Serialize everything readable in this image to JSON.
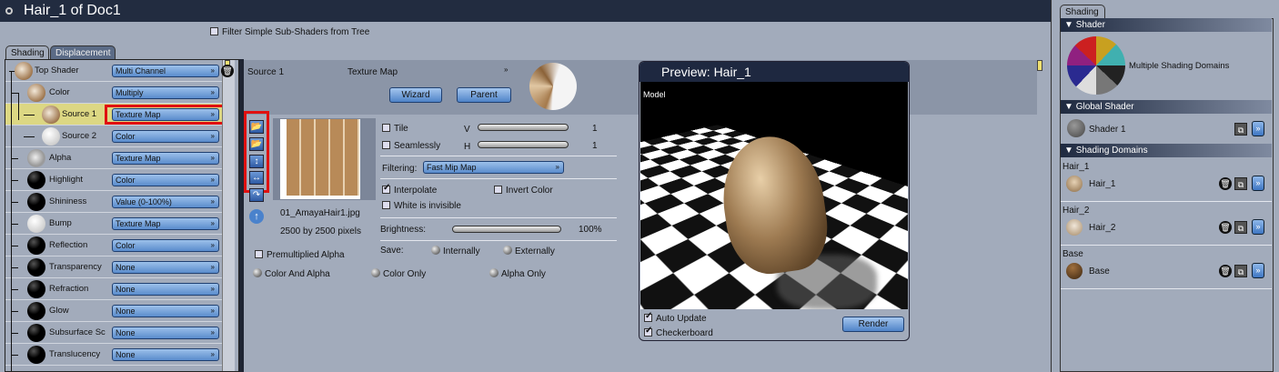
{
  "title": "Hair_1 of Doc1",
  "filter_label": "Filter Simple Sub-Shaders from Tree",
  "tabs": [
    "Shading",
    "Displacement"
  ],
  "tree": [
    {
      "label": "Top Shader",
      "value": "Multi Channel",
      "ball": "hair",
      "level": 0
    },
    {
      "label": "Color",
      "value": "Multiply",
      "ball": "hair",
      "level": 1
    },
    {
      "label": "Source 1",
      "value": "Texture Map",
      "ball": "hair",
      "level": 2,
      "selected": true
    },
    {
      "label": "Source 2",
      "value": "Color",
      "ball": "white",
      "level": 2
    },
    {
      "label": "Alpha",
      "value": "Texture Map",
      "ball": "alpha",
      "level": 1
    },
    {
      "label": "Highlight",
      "value": "Color",
      "ball": "black",
      "level": 1
    },
    {
      "label": "Shininess",
      "value": "Value (0-100%)",
      "ball": "black",
      "level": 1
    },
    {
      "label": "Bump",
      "value": "Texture Map",
      "ball": "white",
      "level": 1
    },
    {
      "label": "Reflection",
      "value": "Color",
      "ball": "black",
      "level": 1
    },
    {
      "label": "Transparency",
      "value": "None",
      "ball": "black",
      "level": 1
    },
    {
      "label": "Refraction",
      "value": "None",
      "ball": "black",
      "level": 1
    },
    {
      "label": "Glow",
      "value": "None",
      "ball": "black",
      "level": 1
    },
    {
      "label": "Subsurface Sc",
      "value": "None",
      "ball": "black",
      "level": 1
    },
    {
      "label": "Translucency",
      "value": "None",
      "ball": "black",
      "level": 1
    }
  ],
  "source": {
    "name": "Source 1",
    "type": "Texture Map",
    "wizard": "Wizard",
    "parent": "Parent",
    "filename": "01_AmayaHair1.jpg",
    "dimensions": "2500 by 2500 pixels",
    "tile": "Tile",
    "seamlessly": "Seamlessly",
    "v_label": "V",
    "h_label": "H",
    "v_value": "1",
    "h_value": "1",
    "filtering_label": "Filtering:",
    "filtering_value": "Fast Mip Map",
    "interpolate": "Interpolate",
    "invert_color": "Invert Color",
    "white_invisible": "White is invisible",
    "brightness_label": "Brightness:",
    "brightness_value": "100%",
    "save_label": "Save:",
    "internally": "Internally",
    "externally": "Externally",
    "premultiplied": "Premultiplied Alpha",
    "color_and_alpha": "Color And Alpha",
    "color_only": "Color Only",
    "alpha_only": "Alpha Only"
  },
  "preview": {
    "title": "Preview: Hair_1",
    "model_label": "Model",
    "auto_update": "Auto Update",
    "checkerboard": "Checkerboard",
    "render": "Render"
  },
  "right": {
    "tab": "Shading",
    "shader_header": "Shader",
    "shader_desc": "Multiple Shading Domains",
    "global_header": "Global Shader",
    "global_name": "Shader 1",
    "domains_header": "Shading Domains",
    "domains": [
      {
        "group": "Hair_1",
        "name": "Hair_1"
      },
      {
        "group": "Hair_2",
        "name": "Hair_2"
      },
      {
        "group": "Base",
        "name": "Base"
      }
    ]
  },
  "colors": {
    "accent": "#5a8ccc",
    "highlight": "#dcd783",
    "titlebar": "#222c40",
    "selection_box": "#e00000"
  }
}
